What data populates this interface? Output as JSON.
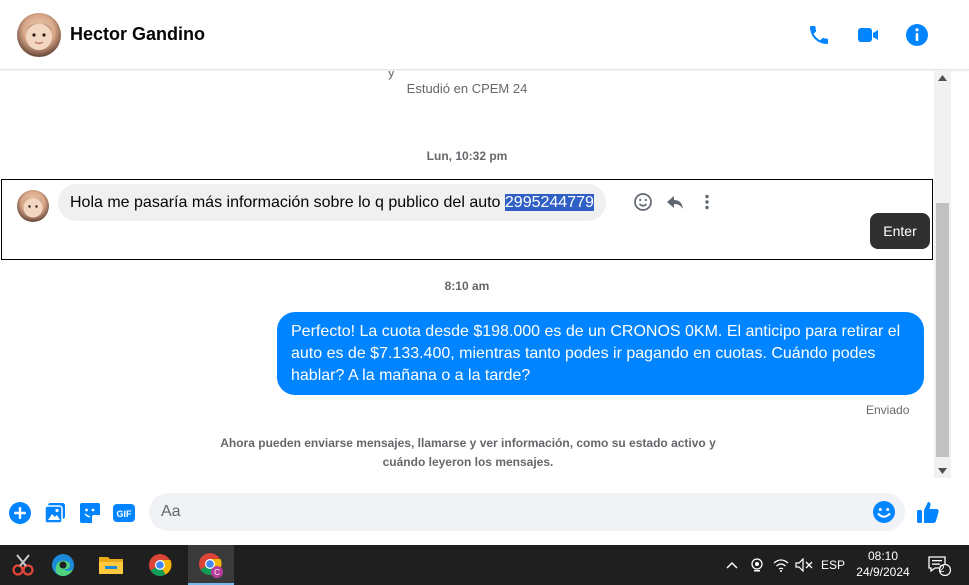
{
  "header": {
    "contact_name": "Hector Gandino"
  },
  "conversation": {
    "profile_cut_text": "y",
    "profile_subtitle": "Estudió en CPEM 24",
    "timestamp_1": "Lun, 10:32 pm",
    "incoming_message": {
      "text": "Hola me pasaría más información sobre lo q publico del auto ",
      "selected_text": "2995244779"
    },
    "tooltip": "Enter",
    "timestamp_2": "8:10 am",
    "outgoing_message": "Perfecto! La cuota desde $198.000 es de un CRONOS 0KM. El anticipo para retirar el auto es de $7.133.400, mientras tanto podes ir pagando en cuotas. Cuándo podes hablar? A la mañana o a la tarde?",
    "status": "Enviado",
    "notice": "Ahora pueden enviarse mensajes, llamarse y ver información, como su estado activo y cuándo leyeron los mensajes."
  },
  "composer": {
    "placeholder": "Aa",
    "value": ""
  },
  "taskbar": {
    "language": "ESP",
    "time": "08:10",
    "date": "24/9/2024",
    "notification_count": "2"
  },
  "colors": {
    "accent": "#0084ff",
    "incoming_bubble": "#f0f0f0",
    "selection": "#3060c6",
    "taskbar": "#1f1f1f"
  },
  "icons": {
    "header": [
      "phone-icon",
      "video-camera-icon",
      "info-icon"
    ],
    "message_actions": [
      "emoji-react-icon",
      "reply-icon",
      "more-options-icon"
    ],
    "composer": [
      "plus-icon",
      "gallery-icon",
      "sticker-icon",
      "gif-icon",
      "emoji-icon",
      "thumbs-up-icon"
    ],
    "taskbar": [
      "snipping-tool-icon",
      "edge-icon",
      "file-explorer-icon",
      "chrome-icon",
      "chrome-profile-icon"
    ],
    "tray": [
      "chevron-up-icon",
      "camera-privacy-icon",
      "wifi-icon",
      "volume-muted-icon",
      "notification-icon"
    ]
  }
}
